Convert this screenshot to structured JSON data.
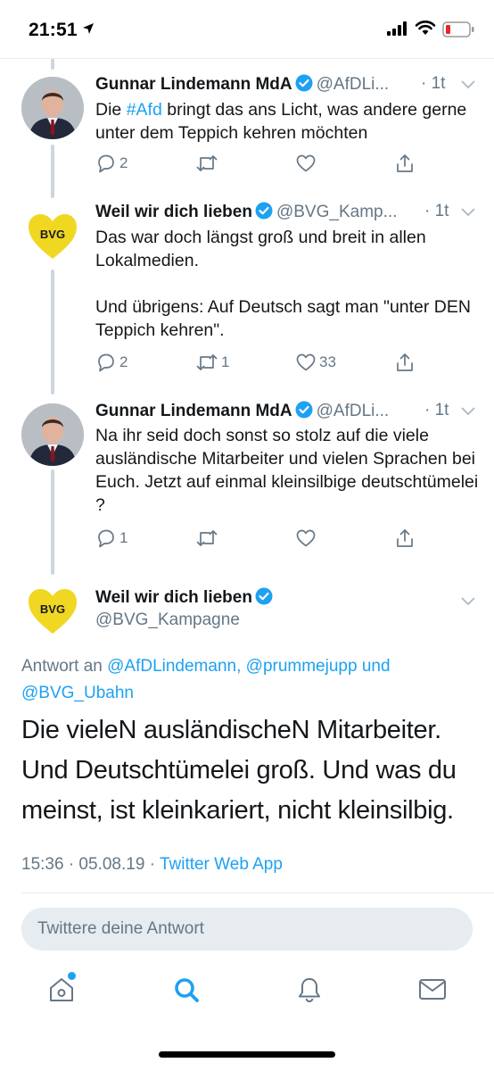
{
  "status_bar": {
    "time": "21:51",
    "icons": [
      "location-arrow-icon",
      "cellular-signal-icon",
      "wifi-icon",
      "battery-low-icon"
    ]
  },
  "thread": [
    {
      "author_name": "Gunnar Lindemann MdA",
      "verified": true,
      "handle": "@AfDLi...",
      "time": "· 1t",
      "text_before": "Die ",
      "hashtag": "#Afd",
      "text_after": " bringt das ans Licht, was andere gerne unter dem Teppich kehren möchten",
      "replies": "2",
      "retweets": "",
      "likes": ""
    },
    {
      "author_name": "Weil wir dich lieben",
      "verified": true,
      "handle": "@BVG_Kamp...",
      "time": "· 1t",
      "avatar_text": "BVG",
      "text_p1": "Das war doch längst groß und breit in allen Lokalmedien.",
      "text_p2": "Und übrigens: Auf Deutsch sagt man \"unter DEN Teppich kehren\".",
      "replies": "2",
      "retweets": "1",
      "likes": "33"
    },
    {
      "author_name": "Gunnar Lindemann MdA",
      "verified": true,
      "handle": "@AfDLi...",
      "time": "· 1t",
      "text": "Na ihr seid doch sonst so stolz auf die viele ausländische Mitarbeiter und vielen Sprachen bei Euch. Jetzt auf einmal kleinsilbige  deutschtümelei ?",
      "replies": "1",
      "retweets": "",
      "likes": ""
    }
  ],
  "main_tweet": {
    "author_name": "Weil wir dich lieben",
    "verified": true,
    "handle": "@BVG_Kampagne",
    "avatar_text": "BVG",
    "reply_prefix": "Antwort an ",
    "reply_user1": "@AfDLindemann,",
    "reply_user2": "@prummejupp",
    "reply_and": " und ",
    "reply_user3": "@BVG_Ubahn",
    "text": "Die vieleN ausländischeN Mitarbeiter. Und Deutschtümelei groß. Und was du meinst, ist kleinkariert, nicht kleinsilbig.",
    "timestamp": "15:36 · 05.08.19 · ",
    "source": "Twitter Web App"
  },
  "reply_input": {
    "placeholder": "Twittere deine Antwort"
  },
  "tab_bar": {
    "tabs": [
      "home-icon",
      "search-icon",
      "notifications-icon",
      "messages-icon"
    ],
    "active": "search-icon"
  },
  "colors": {
    "accent": "#1da1f2",
    "secondary_text": "#657786",
    "bvg_yellow": "#f0d722",
    "thread_line": "#ccd6dd"
  }
}
